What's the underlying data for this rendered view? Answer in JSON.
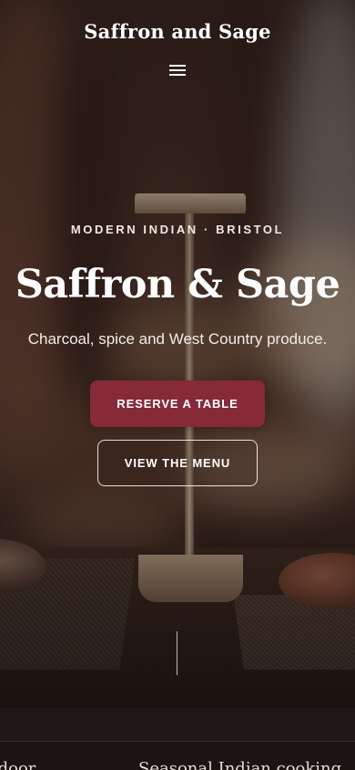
{
  "header": {
    "site_title": "Saffron and Sage",
    "menu_icon": "hamburger-menu-icon"
  },
  "hero": {
    "eyebrow": "MODERN INDIAN · BRISTOL",
    "title": "Saffron & Sage",
    "subtitle": "Charcoal, spice and West Country produce.",
    "primary_cta": "RESERVE A TABLE",
    "secondary_cta": "VIEW THE MENU"
  },
  "highlights": {
    "items": [
      "ndoor",
      "Seasonal Indian cooking"
    ]
  },
  "colors": {
    "accent": "#862a38",
    "background_dark": "#1b1412"
  }
}
